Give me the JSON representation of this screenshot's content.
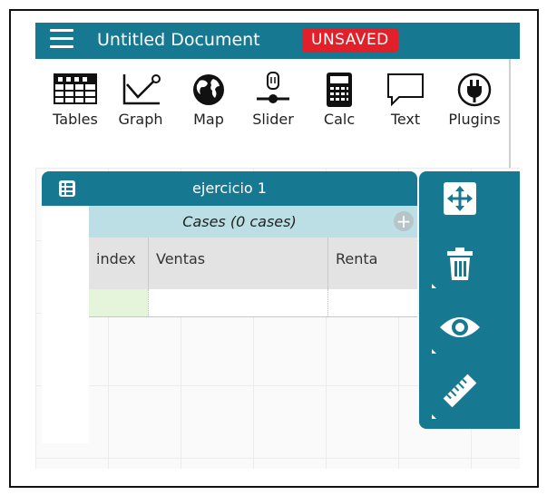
{
  "topbar": {
    "doc_title": "Untitled Document",
    "unsaved_badge": "UNSAVED"
  },
  "toolshelf": {
    "tools": [
      {
        "label": "Tables",
        "icon": "tables-icon"
      },
      {
        "label": "Graph",
        "icon": "graph-icon"
      },
      {
        "label": "Map",
        "icon": "map-icon"
      },
      {
        "label": "Slider",
        "icon": "slider-icon"
      },
      {
        "label": "Calc",
        "icon": "calculator-icon"
      },
      {
        "label": "Text",
        "icon": "text-icon"
      },
      {
        "label": "Plugins",
        "icon": "plugins-icon"
      }
    ]
  },
  "case_table": {
    "title": "ejercicio 1",
    "cases_label": "Cases (0 cases)",
    "columns": [
      "index",
      "Ventas",
      "Renta"
    ]
  },
  "inspector": {
    "buttons": [
      "resize-icon",
      "trash-icon",
      "eye-icon",
      "ruler-icon"
    ]
  },
  "colors": {
    "brand": "#177991",
    "unsaved": "#e2202a",
    "cases_header": "#bcdfe6",
    "column_header": "#e3e3e3"
  }
}
